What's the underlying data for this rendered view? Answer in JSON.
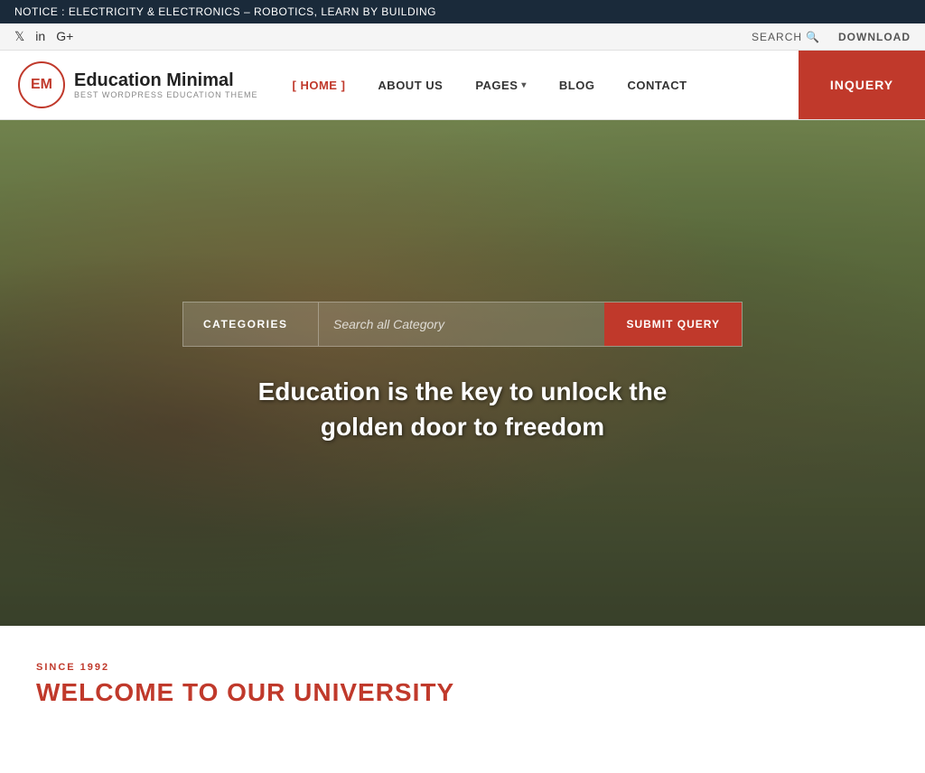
{
  "notice": {
    "text": "NOTICE : ELECTRICITY & ELECTRONICS – ROBOTICS, LEARN BY BUILDING"
  },
  "topbar": {
    "social": [
      {
        "name": "twitter",
        "symbol": "𝕏"
      },
      {
        "name": "linkedin",
        "symbol": "in"
      },
      {
        "name": "google-plus",
        "symbol": "G+"
      }
    ],
    "search_label": "SEARCH",
    "download_label": "DOWNLOAD"
  },
  "nav": {
    "logo_initials": "EM",
    "logo_name": "Education Minimal",
    "logo_tagline": "BEST WORDPRESS EDUCATION THEME",
    "items": [
      {
        "label": "[ HOME ]",
        "active": true
      },
      {
        "label": "ABOUT US",
        "active": false
      },
      {
        "label": "PAGES",
        "active": false,
        "has_dropdown": true
      },
      {
        "label": "BLOG",
        "active": false
      },
      {
        "label": "CONTACT",
        "active": false
      }
    ],
    "inquery_label": "INQUERY"
  },
  "hero": {
    "search_category_label": "CATEGORIES",
    "search_placeholder": "Search all Category",
    "submit_label": "SUBMIT QUERY",
    "tagline": "Education is the key to unlock the golden door to freedom"
  },
  "below_hero": {
    "since_label": "SINCE 1992",
    "welcome_title": "WELCOME TO OUR UNIVERSITY"
  }
}
